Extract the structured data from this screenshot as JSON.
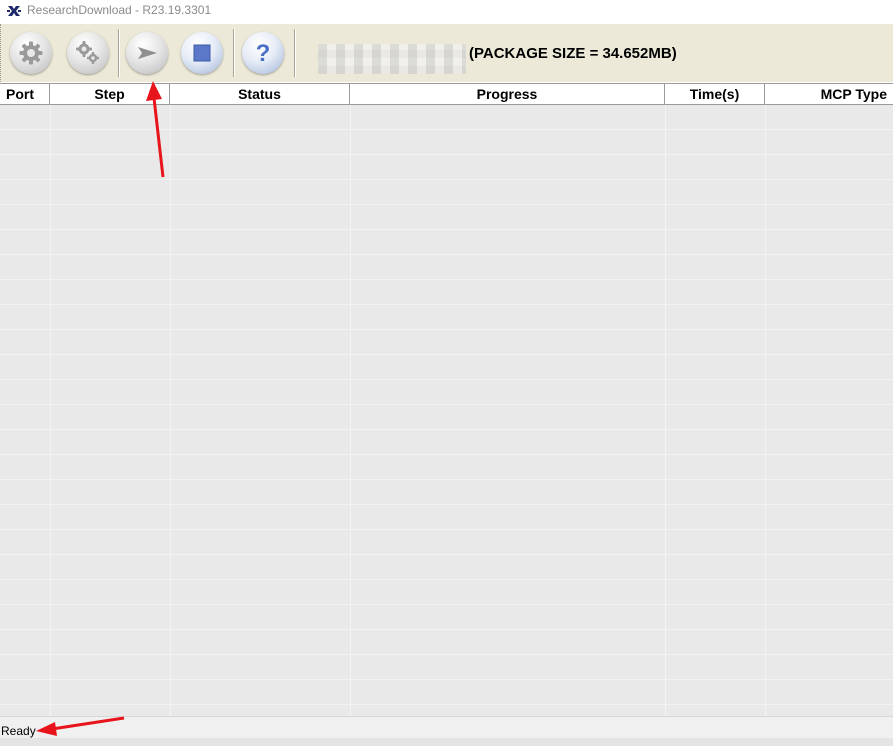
{
  "window": {
    "title": "ResearchDownload - R23.19.3301",
    "icon": "research-download-app-icon"
  },
  "toolbar": {
    "buttons": [
      {
        "name": "load-packet",
        "icon": "gear-icon"
      },
      {
        "name": "settings",
        "icon": "gears-icon"
      },
      {
        "name": "start-download",
        "icon": "play-arrow-icon"
      },
      {
        "name": "stop-download",
        "icon": "stop-square-icon"
      },
      {
        "name": "about",
        "icon": "question-icon"
      }
    ],
    "package_label": "(PACKAGE SIZE = 34.652MB)"
  },
  "table": {
    "columns": [
      "Port",
      "Step",
      "Status",
      "Progress",
      "Time(s)",
      "MCP Type"
    ],
    "rows": []
  },
  "status_bar": {
    "text": "Ready"
  },
  "colors": {
    "toolbar_bg": "#ece9d8",
    "list_bg": "#e9e9e9",
    "annotation_arrow": "#e8141b"
  }
}
